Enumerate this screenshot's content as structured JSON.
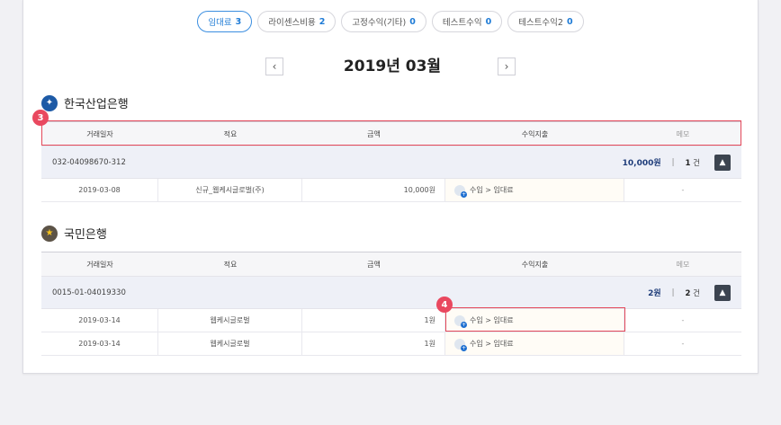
{
  "tabs": [
    {
      "label": "임대료",
      "count": "3",
      "active": true
    },
    {
      "label": "라이센스비용",
      "count": "2",
      "active": false
    },
    {
      "label": "고정수익(기타)",
      "count": "0",
      "active": false
    },
    {
      "label": "테스트수익",
      "count": "0",
      "active": false
    },
    {
      "label": "테스트수익2",
      "count": "0",
      "active": false
    }
  ],
  "month": {
    "title": "2019년 03월",
    "prev": "‹",
    "next": "›"
  },
  "columns": [
    "거래일자",
    "적요",
    "금액",
    "수익지출",
    "메모"
  ],
  "banks": [
    {
      "name": "한국산업은행",
      "logo": "✦",
      "account": {
        "number": "032-04098670-312",
        "amount": "10,000원",
        "sep": "|",
        "count": "1",
        "unit": "건",
        "toggle": "▲"
      },
      "rows": [
        {
          "date": "2019-03-08",
          "desc": "신규_웹케시글로벌(주)",
          "amount": "10,000원",
          "category": "수입 > 임대료",
          "memo": "-"
        }
      ]
    },
    {
      "name": "국민은행",
      "logo": "★",
      "account": {
        "number": "0015-01-04019330",
        "amount": "2원",
        "sep": "|",
        "count": "2",
        "unit": "건",
        "toggle": "▲"
      },
      "rows": [
        {
          "date": "2019-03-14",
          "desc": "웹케시글로벌",
          "amount": "1원",
          "category": "수입 > 임대료",
          "memo": "-"
        },
        {
          "date": "2019-03-14",
          "desc": "웹케시글로벌",
          "amount": "1원",
          "category": "수입 > 임대료",
          "memo": "-"
        }
      ]
    }
  ],
  "markers": {
    "m3": "3",
    "m4": "4"
  },
  "colors": {
    "accent": "#1e7bd6",
    "highlight": "#e4485a",
    "marker": "#e9485f"
  }
}
